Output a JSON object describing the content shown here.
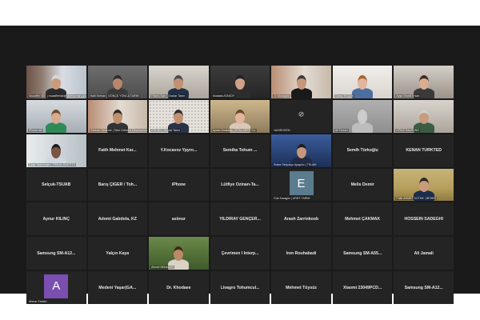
{
  "meeting": {
    "view": "gallery",
    "tiles": [
      {
        "label": "Muzaffer IŞIK | muzafferisik@tarimorman.gov.tr",
        "kind": "video",
        "scene": "office-window",
        "skin": "#c99a7c",
        "hair": "#d8d8d8",
        "shirt": "#2b2b2b"
      },
      {
        "label": "Halil Serhan | GÖNÇE YÖNCA TARIM",
        "kind": "video",
        "scene": "grey-room",
        "skin": "#b8866a",
        "hair": "#2c2c2c",
        "shirt": "#3a3a3a"
      },
      {
        "label": "Hüsnü Sarı | Granar Tarım",
        "kind": "video",
        "scene": "light-room",
        "skin": "#c29172",
        "hair": "#4a4a4a",
        "shirt": "#1f2f45"
      },
      {
        "label": "Mustafa ATASOY",
        "kind": "video",
        "scene": "dark-room",
        "skin": "#d0a28a",
        "hair": "#222222",
        "shirt": "#2d2d2d"
      },
      {
        "label": "Zİ Günaydın",
        "kind": "video",
        "scene": "window-room",
        "skin": "#c6977c",
        "hair": "#3b3b3b",
        "shirt": "#1a1a1a"
      },
      {
        "label": "Öznur KOÇAK",
        "kind": "video",
        "scene": "white-wall",
        "skin": "#e0b59c",
        "hair": "#a8622c",
        "shirt": "#4c6fa0"
      },
      {
        "label": "Ayşe Sevdil Erkan",
        "kind": "video",
        "scene": "bookshelf",
        "skin": "#d9ad92",
        "hair": "#3d2a22",
        "shirt": "#3a3a3a"
      },
      {
        "label": "iPhone eth",
        "kind": "video",
        "scene": "office",
        "skin": "#d8ab8f",
        "hair": "#6b4a2d",
        "shirt": "#2f8a5a"
      },
      {
        "label": "Gökhan Özdemir | Tahıl Ürünleri Tohumculuk",
        "kind": "video",
        "scene": "window-room",
        "skin": "#c1906f",
        "hair": "#2a2a2a",
        "shirt": "#333333"
      },
      {
        "label": "ERHAN | Hayrat Tarım",
        "kind": "video",
        "scene": "dotted-wall",
        "skin": "#c49073",
        "hair": "#2f2f2f",
        "shirt": "#2a3345"
      },
      {
        "label": "Aycan Ocakbaş | ATSA SEED Co.",
        "kind": "video",
        "scene": "yellow-room",
        "skin": "#e1b69b",
        "hair": "#6b4429",
        "shirt": "#d9c8b9"
      },
      {
        "label": "NASROSEN",
        "kind": "camoff",
        "name": ""
      },
      {
        "label": "Ali Tohum",
        "kind": "video",
        "scene": "grey-wall",
        "skin": "#cccccc",
        "hair": "#cccccc",
        "shirt": "#bdbdbd"
      },
      {
        "label": "OĞUZ SALKUNG",
        "kind": "video",
        "scene": "light-room",
        "skin": "#c89b80",
        "hair": "#cfcfcf",
        "shirt": "#3b5b42"
      },
      {
        "label": "Galip Taşkınoğlu | TRİKAL ENSTITÜ",
        "kind": "video",
        "scene": "bright-window",
        "skin": "#7a5545",
        "hair": "#1c1c1c",
        "shirt": "#cfd7df"
      },
      {
        "label": "",
        "kind": "name",
        "name": "Fatih Mehmet Kar..."
      },
      {
        "label": "",
        "kind": "name",
        "name": "Y.Kocavoz Ypyro..."
      },
      {
        "label": "",
        "kind": "name",
        "name": "Semiha Tohum ..."
      },
      {
        "label": "Buket Selçukçu Ayaydın | TSUAB",
        "kind": "video",
        "scene": "blue-stage",
        "skin": "#c6977c",
        "hair": "#1f1f1f",
        "shirt": "#1f2b44"
      },
      {
        "label": "",
        "kind": "name",
        "name": "Semih Türkoğlu"
      },
      {
        "label": "",
        "kind": "name",
        "name": "KENAN TURKTED"
      },
      {
        "label": "",
        "kind": "name",
        "name": "Selçuk-TSUAB"
      },
      {
        "label": "",
        "kind": "name",
        "name": "Barış ÇİĞER / Toh..."
      },
      {
        "label": "",
        "kind": "name",
        "name": "iPhone"
      },
      {
        "label": "",
        "kind": "name",
        "name": "Lütfiye Özinan-Ta..."
      },
      {
        "label": "Eda Karagöz | ARES TARIM",
        "kind": "avatar",
        "letter": "E",
        "color": "#5b7c8f"
      },
      {
        "label": "",
        "kind": "name",
        "name": "Melis Demir"
      },
      {
        "label": "Fatih AHMET KÜTÜK | BESEN",
        "kind": "video",
        "scene": "field",
        "skin": "#c99a7c",
        "hair": "#2a2a2a",
        "shirt": "#1c2c4c"
      },
      {
        "label": "",
        "kind": "name",
        "name": "Aynur KILINÇ"
      },
      {
        "label": "",
        "kind": "name",
        "name": "Adomi Gabdola, KZ"
      },
      {
        "label": "",
        "kind": "name",
        "name": "aslınur"
      },
      {
        "label": "",
        "kind": "name",
        "name": "YILDIRAY GENÇER..."
      },
      {
        "label": "",
        "kind": "name",
        "name": "Arash Zarrinkoob"
      },
      {
        "label": "",
        "kind": "name",
        "name": "Mehmet ÇAKMAK"
      },
      {
        "label": "",
        "kind": "name",
        "name": "HOSSEIN SADEGHI"
      },
      {
        "label": "",
        "kind": "name",
        "name": "Samsung SM-A12..."
      },
      {
        "label": "",
        "kind": "name",
        "name": "Yalçın Kaya"
      },
      {
        "label": "Ahmet Mühesrinli",
        "kind": "video",
        "scene": "greenery",
        "skin": "#b98a6a",
        "hair": "#3a2a1a",
        "shirt": "#d9d2c5"
      },
      {
        "label": "",
        "kind": "name",
        "name": "Çevrimen I Interp..."
      },
      {
        "label": "",
        "kind": "name",
        "name": "Iren Rouhabadi"
      },
      {
        "label": "",
        "kind": "name",
        "name": "Samsung SM-A55..."
      },
      {
        "label": "",
        "kind": "name",
        "name": "Ali Jamali"
      },
      {
        "label": "Afshar Estathi",
        "kind": "avatar",
        "letter": "A",
        "color": "#7a4fb0"
      },
      {
        "label": "",
        "kind": "name",
        "name": "Medeni Yaşar(GA..."
      },
      {
        "label": "",
        "kind": "name",
        "name": "Dr. Khodaee"
      },
      {
        "label": "",
        "kind": "name",
        "name": "Livagro Tohumcul..."
      },
      {
        "label": "",
        "kind": "name",
        "name": "Mehmet Tüysüz"
      },
      {
        "label": "",
        "kind": "name",
        "name": "Xiaomi 23049PCD..."
      },
      {
        "label": "",
        "kind": "name",
        "name": "Samsung SM-A12..."
      }
    ]
  }
}
